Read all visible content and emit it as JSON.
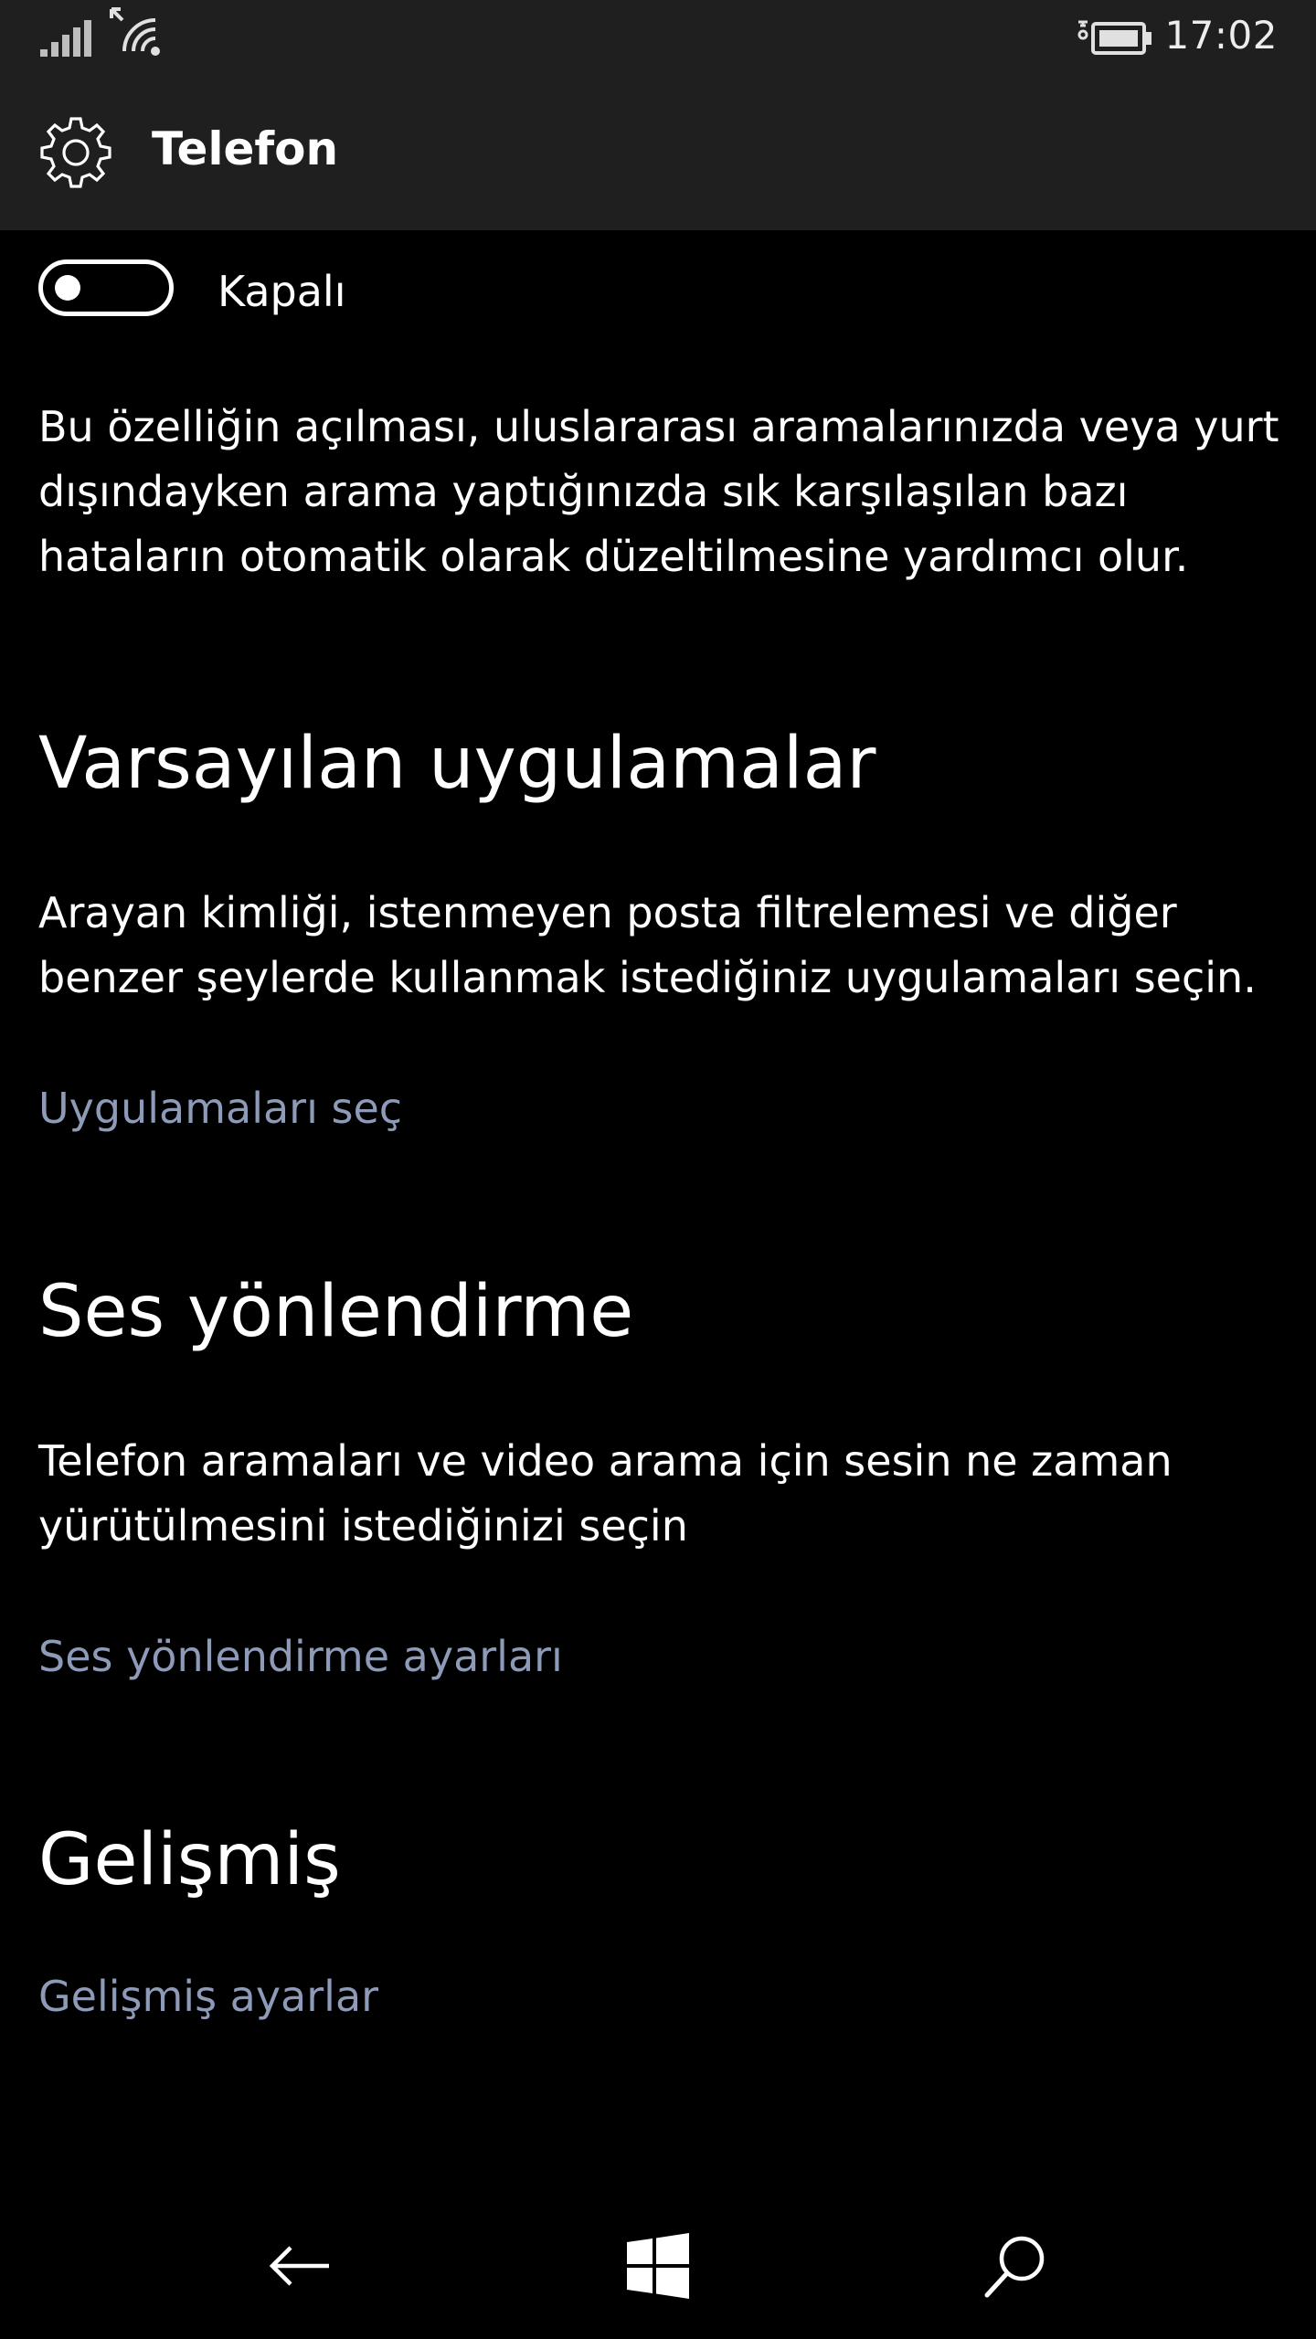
{
  "status_bar": {
    "time": "17:02",
    "icons": [
      "signal-icon",
      "wifi-icon",
      "battery-icon"
    ]
  },
  "header": {
    "icon": "gear-icon",
    "title": "Telefon"
  },
  "toggle": {
    "state": "off",
    "label": "Kapalı"
  },
  "toggle_description": "Bu özelliğin açılması, uluslararası aramalarınızda veya yurt dışındayken arama yaptığınızda sık karşılaşılan bazı hataların otomatik olarak düzeltilmesine yardımcı olur.",
  "sections": {
    "default_apps": {
      "heading": "Varsayılan uygulamalar",
      "description": "Arayan kimliği, istenmeyen posta filtrelemesi ve diğer benzer şeylerde kullanmak istediğiniz uygulamaları seçin.",
      "link": "Uygulamaları seç"
    },
    "audio_routing": {
      "heading": "Ses yönlendirme",
      "description": "Telefon aramaları ve video arama için sesin ne zaman yürütülmesini istediğinizi seçin",
      "link": "Ses yönlendirme ayarları"
    },
    "advanced": {
      "heading": "Gelişmiş",
      "link": "Gelişmiş ayarlar"
    }
  },
  "nav_bar": {
    "icons": [
      "back-arrow-icon",
      "windows-start-icon",
      "search-icon"
    ]
  },
  "colors": {
    "background": "#000000",
    "chrome": "#1f1f1f",
    "text": "#ffffff",
    "link": "#8e9bb8"
  }
}
